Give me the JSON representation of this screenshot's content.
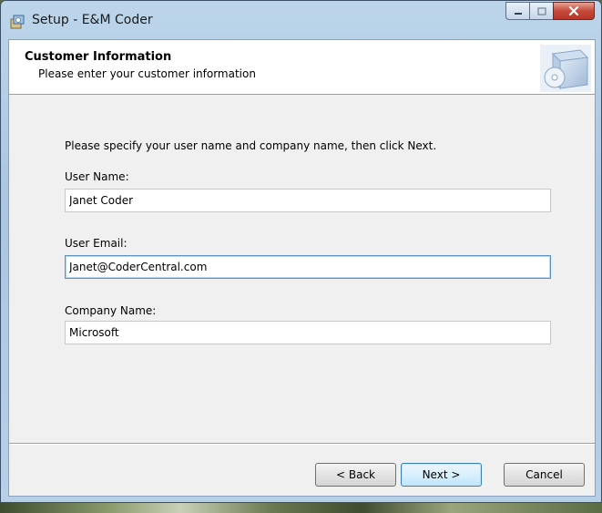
{
  "window": {
    "title": "Setup - E&M Coder"
  },
  "header": {
    "title": "Customer Information",
    "subtitle": "Please enter your customer information"
  },
  "form": {
    "instruction": "Please specify your user name and company name, then click Next.",
    "user_name": {
      "label": "User Name:",
      "value": "Janet Coder"
    },
    "user_email": {
      "label": "User Email:",
      "value": "Janet@CoderCentral.com"
    },
    "company_name": {
      "label": "Company Name:",
      "value": "Microsoft"
    }
  },
  "buttons": {
    "back": "< Back",
    "next": "Next >",
    "cancel": "Cancel"
  },
  "icons": {
    "app": "setup-installer-icon",
    "header_art": "install-disc-box-icon",
    "minimize": "minimize-icon",
    "maximize": "maximize-icon",
    "close": "close-icon"
  },
  "colors": {
    "titlebar": "#b7d0e8",
    "client_bg": "#f0f0f0",
    "header_bg": "#ffffff",
    "close_button": "#c6493a",
    "focus_border": "#5c93bf"
  }
}
